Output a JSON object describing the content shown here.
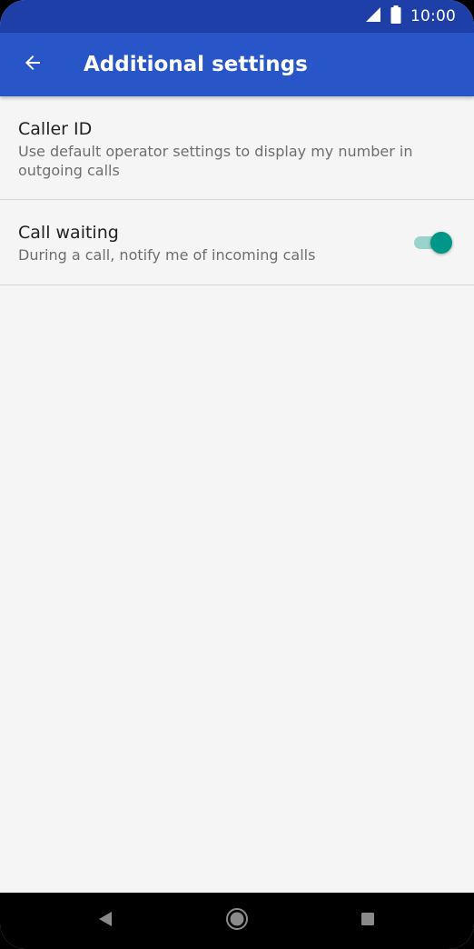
{
  "status_bar": {
    "time": "10:00",
    "icons": [
      "signal-icon",
      "battery-icon"
    ]
  },
  "app_bar": {
    "title": "Additional settings",
    "back_icon": "back-arrow-icon",
    "color": "#2855c8",
    "status_color": "#1e3fa7"
  },
  "settings": {
    "items": [
      {
        "title": "Caller ID",
        "summary": "Use default operator settings to display my number in outgoing calls"
      },
      {
        "title": "Call waiting",
        "summary": "During a call, notify me of incoming calls",
        "toggle_on": true,
        "toggle_color": "#009688"
      }
    ]
  },
  "nav_bar": {
    "buttons": [
      "back-triangle-icon",
      "home-circle-icon",
      "recents-square-icon"
    ]
  }
}
